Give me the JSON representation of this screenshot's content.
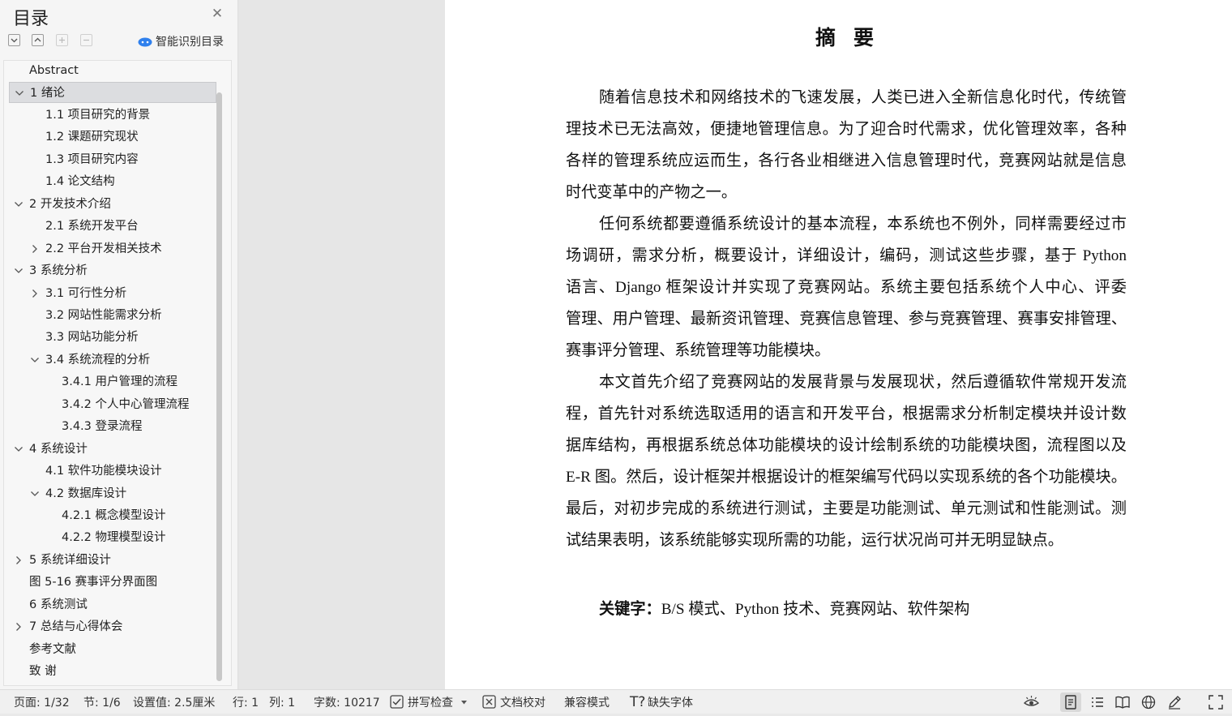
{
  "toc": {
    "title": "目录",
    "smart_toc_label": "智能识别目录",
    "toolbar_icons": [
      "collapse-all-icon",
      "expand-all-icon",
      "add-heading-icon",
      "remove-heading-icon"
    ],
    "items": [
      {
        "label": "Abstract",
        "level": 1,
        "expander": "none",
        "selected": false
      },
      {
        "label": "1 绪论",
        "level": 1,
        "expander": "expanded",
        "selected": true
      },
      {
        "label": "1.1 项目研究的背景",
        "level": 2,
        "expander": "none",
        "selected": false
      },
      {
        "label": "1.2 课题研究现状",
        "level": 2,
        "expander": "none",
        "selected": false
      },
      {
        "label": "1.3 项目研究内容",
        "level": 2,
        "expander": "none",
        "selected": false
      },
      {
        "label": "1.4 论文结构",
        "level": 2,
        "expander": "none",
        "selected": false
      },
      {
        "label": "2 开发技术介绍",
        "level": 1,
        "expander": "expanded",
        "selected": false
      },
      {
        "label": "2.1  系统开发平台",
        "level": 2,
        "expander": "none",
        "selected": false
      },
      {
        "label": "2.2  平台开发相关技术",
        "level": 2,
        "expander": "collapsed",
        "selected": false
      },
      {
        "label": "3 系统分析",
        "level": 1,
        "expander": "expanded",
        "selected": false
      },
      {
        "label": "3.1 可行性分析",
        "level": 2,
        "expander": "collapsed",
        "selected": false
      },
      {
        "label": "3.2 网站性能需求分析",
        "level": 2,
        "expander": "none",
        "selected": false
      },
      {
        "label": "3.3 网站功能分析",
        "level": 2,
        "expander": "none",
        "selected": false
      },
      {
        "label": "3.4 系统流程的分析",
        "level": 2,
        "expander": "expanded",
        "selected": false
      },
      {
        "label": "3.4.1  用户管理的流程",
        "level": 3,
        "expander": "none",
        "selected": false
      },
      {
        "label": "3.4.2  个人中心管理流程",
        "level": 3,
        "expander": "none",
        "selected": false
      },
      {
        "label": "3.4.3  登录流程",
        "level": 3,
        "expander": "none",
        "selected": false
      },
      {
        "label": "4 系统设计",
        "level": 1,
        "expander": "expanded",
        "selected": false
      },
      {
        "label": "4.1  软件功能模块设计",
        "level": 2,
        "expander": "none",
        "selected": false
      },
      {
        "label": "4.2  数据库设计",
        "level": 2,
        "expander": "expanded",
        "selected": false
      },
      {
        "label": "4.2.1  概念模型设计",
        "level": 3,
        "expander": "none",
        "selected": false
      },
      {
        "label": "4.2.2  物理模型设计",
        "level": 3,
        "expander": "none",
        "selected": false
      },
      {
        "label": "5 系统详细设计",
        "level": 1,
        "expander": "collapsed",
        "selected": false
      },
      {
        "label": "图 5-16 赛事评分界面图",
        "level": 1,
        "expander": "none",
        "selected": false
      },
      {
        "label": "6 系统测试",
        "level": 1,
        "expander": "none",
        "selected": false
      },
      {
        "label": "7 总结与心得体会",
        "level": 1,
        "expander": "collapsed",
        "selected": false
      },
      {
        "label": "参考文献",
        "level": 1,
        "expander": "none",
        "selected": false
      },
      {
        "label": "致  谢",
        "level": 1,
        "expander": "none",
        "selected": false
      }
    ]
  },
  "document": {
    "title": "摘要",
    "paragraphs": [
      [
        "随着信息技术和网络技术的飞速发展，人类已进入全新信息化时代，传统管",
        "理技术已无法高效，便捷地管理信息。为了迎合时代需求，优化管理效率，各种",
        "各样的管理系统应运而生，各行各业相继进入信息管理时代，竞赛网站就是信息",
        "时代变革中的产物之一。"
      ],
      [
        "任何系统都要遵循系统设计的基本流程，本系统也不例外，同样需要经过市",
        "场调研，需求分析，概要设计，详细设计，编码，测试这些步骤，基于 Python",
        "语言、Django 框架设计并实现了竞赛网站。系统主要包括系统个人中心、评委",
        "管理、用户管理、最新资讯管理、竞赛信息管理、参与竞赛管理、赛事安排管理、",
        "赛事评分管理、系统管理等功能模块。"
      ],
      [
        "本文首先介绍了竞赛网站的发展背景与发展现状，然后遵循软件常规开发流",
        "程，首先针对系统选取适用的语言和开发平台，根据需求分析制定模块并设计数",
        "据库结构，再根据系统总体功能模块的设计绘制系统的功能模块图，流程图以及",
        "E-R 图。然后，设计框架并根据设计的框架编写代码以实现系统的各个功能模块。",
        "最后，对初步完成的系统进行测试，主要是功能测试、单元测试和性能测试。测",
        "试结果表明，该系统能够实现所需的功能，运行状况尚可并无明显缺点。"
      ]
    ],
    "keywords_label": "关键字：",
    "keywords_value": "B/S 模式、Python 技术、竞赛网站、软件架构"
  },
  "status_bar": {
    "page": "页面: 1/32",
    "section": "节: 1/6",
    "setting": "设置值: 2.5厘米",
    "row": "行: 1",
    "col": "列: 1",
    "word_count": "字数: 10217",
    "spell_check": "拼写检查",
    "doc_proofread": "文档校对",
    "compat_mode": "兼容模式",
    "missing_fonts": "缺失字体",
    "view_icons": [
      "eye-protection-icon",
      "page-view-icon",
      "outline-view-icon",
      "reading-view-icon",
      "web-view-icon",
      "pen-icon",
      "fullscreen-icon"
    ]
  },
  "colors": {
    "selected_bg": "#dcdde0",
    "page_bg": "#ffffff",
    "workspace_bg": "#e6e6e6",
    "smart_toc_accent": "#2f80ed"
  }
}
